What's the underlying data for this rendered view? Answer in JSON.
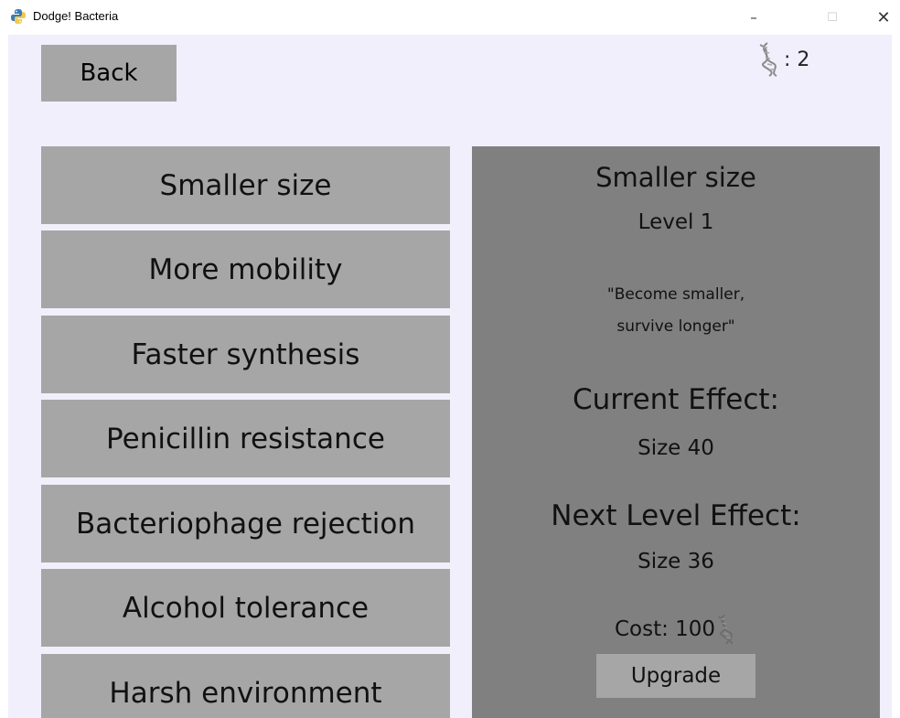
{
  "window": {
    "title": "Dodge! Bacteria",
    "app_icon": "python-icon",
    "controls": {
      "minimize": "–",
      "maximize": "☐",
      "close": "✕"
    }
  },
  "header": {
    "back_label": "Back",
    "dna_icon": "dna-icon",
    "dna_count": ": 2"
  },
  "upgrades": [
    {
      "label": "Smaller size"
    },
    {
      "label": "More mobility"
    },
    {
      "label": "Faster synthesis"
    },
    {
      "label": "Penicillin resistance"
    },
    {
      "label": "Bacteriophage rejection"
    },
    {
      "label": "Alcohol tolerance"
    },
    {
      "label": "Harsh environment"
    }
  ],
  "detail": {
    "title": "Smaller size",
    "level": "Level 1",
    "description_line1": "\"Become smaller,",
    "description_line2": "survive longer\"",
    "current_effect_label": "Current Effect:",
    "current_effect_value": "Size 40",
    "next_effect_label": "Next Level Effect:",
    "next_effect_value": "Size 36",
    "cost": "Cost: 100",
    "upgrade_label": "Upgrade"
  },
  "colors": {
    "background": "#f0effb",
    "button": "#a6a6a6",
    "panel": "#808080"
  }
}
